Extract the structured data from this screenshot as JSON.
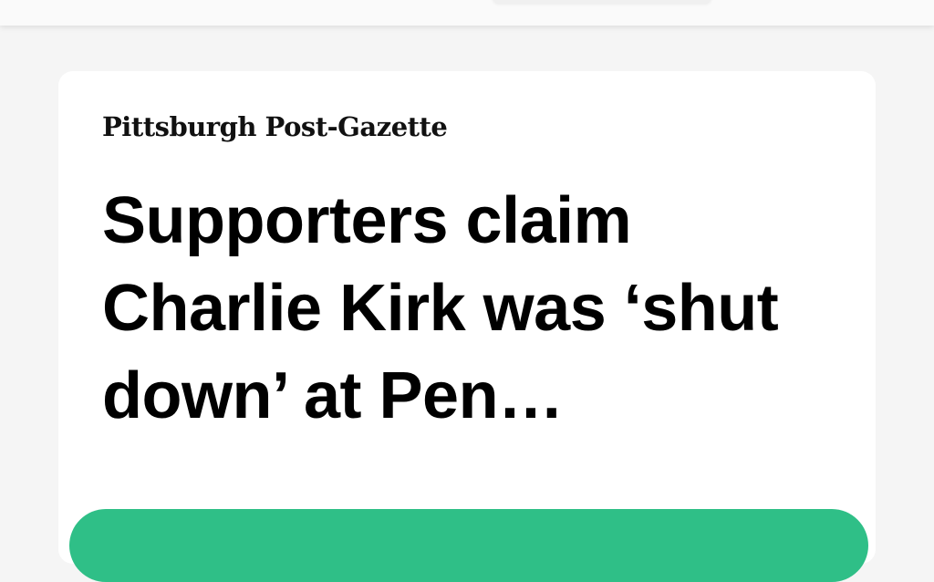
{
  "article_card": {
    "publisher": "Pittsburgh Post-Gazette",
    "headline": "Supporters claim Charlie Kirk was ‘shut down’ at Pen…"
  },
  "colors": {
    "background": "#f5f5f5",
    "card": "#ffffff",
    "action_button": "#2fbf87",
    "text": "#000000"
  }
}
